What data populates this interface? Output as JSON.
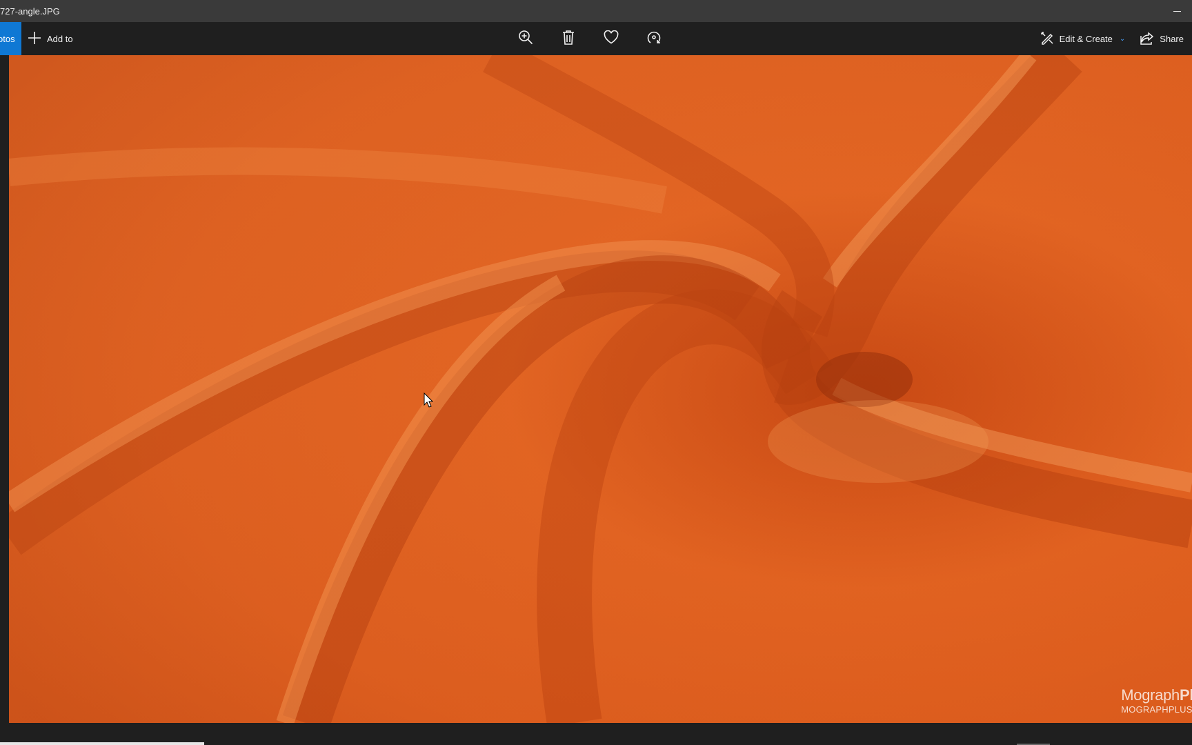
{
  "window": {
    "title": "727-angle.JPG"
  },
  "toolbar": {
    "back_label": "otos",
    "add_to_label": "Add to",
    "center_tools": [
      {
        "name": "zoom-in",
        "icon": "zoom-in-icon"
      },
      {
        "name": "delete",
        "icon": "trash-icon"
      },
      {
        "name": "favorite",
        "icon": "heart-icon"
      },
      {
        "name": "rotate",
        "icon": "rotate-icon"
      }
    ],
    "edit_create_label": "Edit & Create",
    "share_label": "Share"
  },
  "photo": {
    "subject": "orange velvet fabric swirl",
    "watermark_brand": "Mograph",
    "watermark_brand_bold": "Pl",
    "watermark_url": "MOGRAPHPLUS.C"
  },
  "colors": {
    "accent": "#0f78d4",
    "toolbar_bg": "#1f1f1f",
    "titlebar_bg": "#3a3a3a",
    "fabric_base": "#d9561a"
  }
}
